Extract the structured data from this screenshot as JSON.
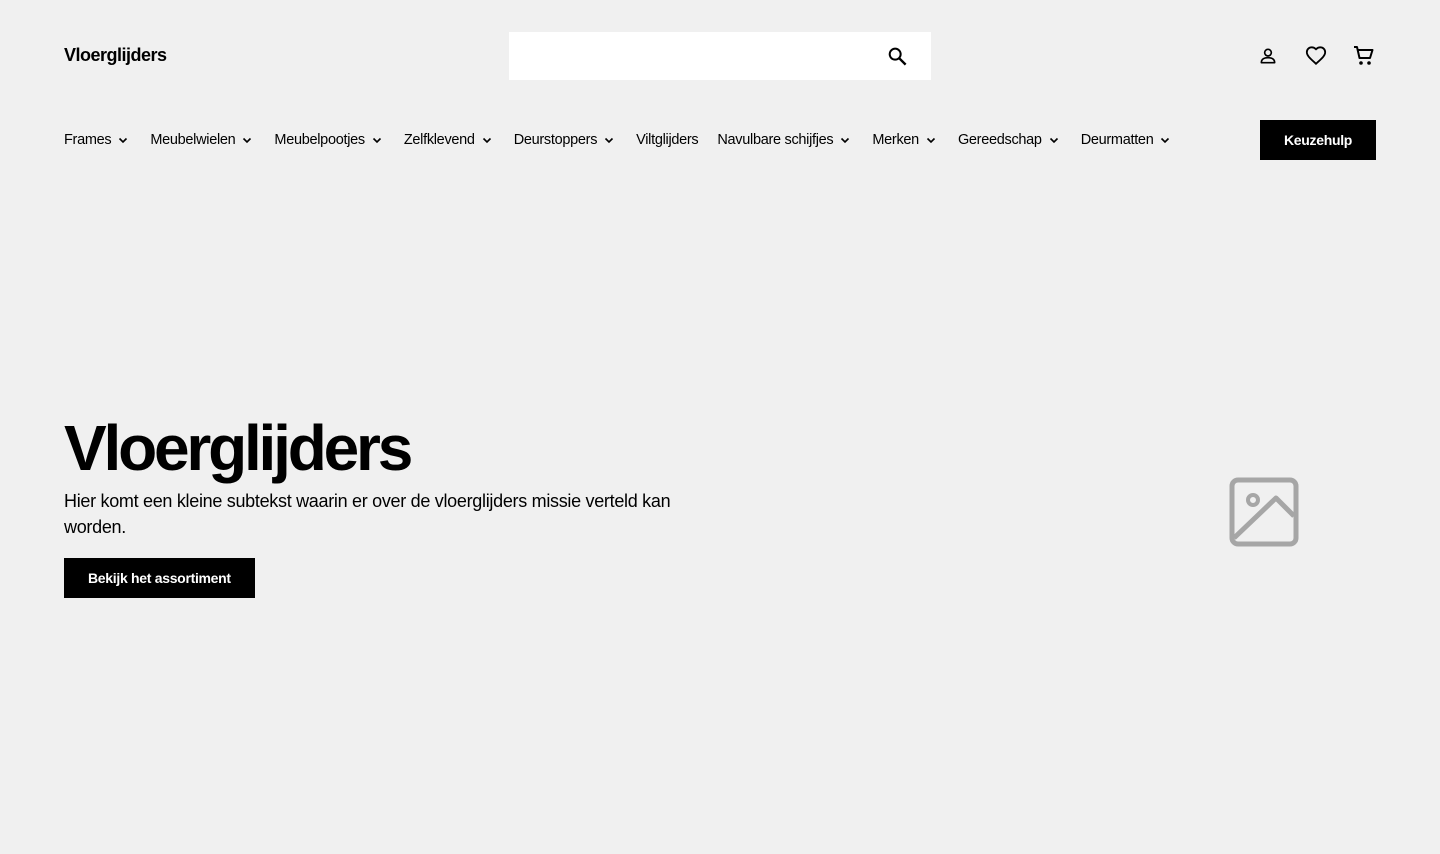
{
  "header": {
    "logo": "Vloerglijders",
    "search": {
      "placeholder": "",
      "value": ""
    },
    "icons": [
      "search-icon",
      "account-icon",
      "heart-icon",
      "cart-icon"
    ]
  },
  "nav": {
    "items": [
      {
        "label": "Frames",
        "has_dropdown": true
      },
      {
        "label": "Meubelwielen",
        "has_dropdown": true
      },
      {
        "label": "Meubelpootjes",
        "has_dropdown": true
      },
      {
        "label": "Zelfklevend",
        "has_dropdown": true
      },
      {
        "label": "Deurstoppers",
        "has_dropdown": true
      },
      {
        "label": "Viltglijders",
        "has_dropdown": false
      },
      {
        "label": "Navulbare schijfjes",
        "has_dropdown": true
      },
      {
        "label": "Merken",
        "has_dropdown": true
      },
      {
        "label": "Gereedschap",
        "has_dropdown": true
      },
      {
        "label": "Deurmatten",
        "has_dropdown": true
      }
    ],
    "cta_label": "Keuzehulp"
  },
  "hero": {
    "title": "Vloerglijders",
    "subtitle": "Hier komt een kleine subtekst waarin er over de vloerglijders missie verteld kan worden.",
    "cta_label": "Bekijk het assortiment",
    "image_icon": "image-placeholder-icon"
  },
  "colors": {
    "background": "#f0f0f0",
    "primary": "#000000",
    "on_primary": "#ffffff",
    "placeholder_icon": "#a6a6a6"
  }
}
